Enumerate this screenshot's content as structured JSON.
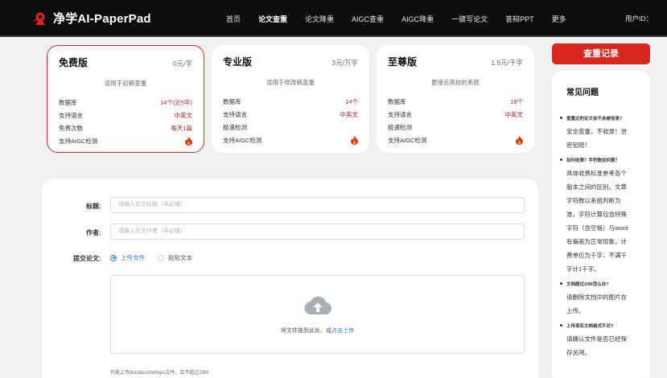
{
  "header": {
    "brand": "净学AI-PaperPad",
    "nav": [
      "首页",
      "论文查重",
      "论文降重",
      "AIGC查重",
      "AIGC降重",
      "一键写论文",
      "答辩PPT",
      "更多"
    ],
    "active_index": 1,
    "user": "用户ID："
  },
  "plans": [
    {
      "name": "免费版",
      "price": "0元/字",
      "desc": "适用于初稿查重",
      "rows": [
        {
          "label": "数据库",
          "value": "14个(近5年)"
        },
        {
          "label": "支持语言",
          "value": "中英文"
        },
        {
          "label": "免费次数",
          "value": "每天1篇"
        },
        {
          "label": "支持AIGC检测",
          "value": ""
        }
      ]
    },
    {
      "name": "专业版",
      "price": "3元/万字",
      "desc": "适用于修改稿查重",
      "rows": [
        {
          "label": "数据库",
          "value": "14个"
        },
        {
          "label": "支持语言",
          "value": "中英文"
        },
        {
          "label": "极速检测",
          "value": ""
        },
        {
          "label": "支持AIGC检测",
          "value": ""
        }
      ]
    },
    {
      "name": "至尊版",
      "price": "1.5元/千字",
      "desc": "更接近高校的系统",
      "rows": [
        {
          "label": "数据库",
          "value": "18个"
        },
        {
          "label": "支持语言",
          "value": "中英文"
        },
        {
          "label": "极速检测",
          "value": ""
        },
        {
          "label": "支持AIGC检测",
          "value": ""
        }
      ]
    }
  ],
  "record_button": "查重记录",
  "faq": {
    "title": "常见问题",
    "items": [
      {
        "q": "查重过的论文会不会被收录?",
        "a": [
          "安全查重，不收录！泄",
          "密包赔！"
        ]
      },
      {
        "q": "如何收费？字符数如何算？",
        "a": [
          "具体收费标准参考各个",
          "版本之间的区别。文章",
          "字符数以系统判断为",
          "准，字符计算包含特殊",
          "字符（含空格）与word",
          "有偏差为正常现象，计",
          "费单位为千字，不满千",
          "字计1千字。"
        ]
      },
      {
        "q": "文档超过20M怎么办?",
        "a": [
          "请删除文档中的图片在",
          "上传。"
        ]
      },
      {
        "q": "上传现实文档格式不对?",
        "a": [
          "请确认文件是否已经保",
          "存关闭。"
        ]
      }
    ]
  },
  "form": {
    "title_label": "标题:",
    "title_placeholder": "请输入论文标题（非必填）",
    "author_label": "作者:",
    "author_placeholder": "请输入论文作者（非必填）",
    "submit_label": "提交论文:",
    "option_upload": "上传文件",
    "option_paste": "粘贴文本",
    "drop_text": "将文件拖到此处，或",
    "drop_link": "点击上传",
    "hint": "只能上传doc/docx/txt/wps文件，且不超过20M"
  },
  "colors": {
    "accent_red": "#d9261c",
    "value_red": "#a4272a",
    "link_blue": "#2d7be5",
    "header_bg": "#0d0d0d"
  }
}
